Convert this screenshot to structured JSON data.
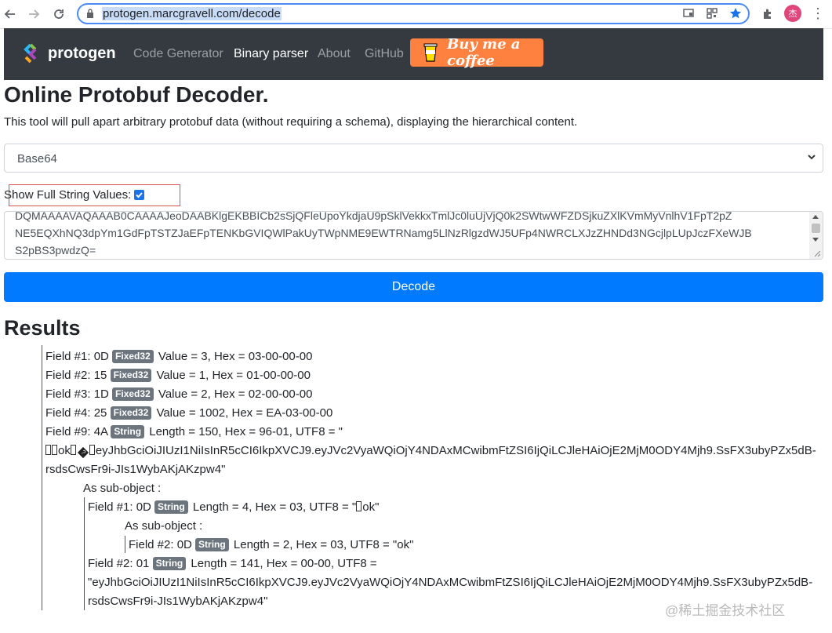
{
  "browser": {
    "url": "protogen.marcgravell.com/decode",
    "avatar_initial": "杰"
  },
  "navbar": {
    "brand": "protogen",
    "links": [
      "Code Generator",
      "Binary parser",
      "About",
      "GitHub"
    ],
    "active_link": "Binary parser",
    "coffee_label": "Buy me a coffee",
    "colors": {
      "bg": "#343a40",
      "coffee": "#ff813f"
    }
  },
  "page": {
    "title": "Online Protobuf Decoder.",
    "description": "This tool will pull apart arbitrary protobuf data (without requiring a schema), displaying the hierarchical content.",
    "encoding_select": "Base64",
    "show_full_label": "Show Full String Values:",
    "show_full_checked": true,
    "input_lines": [
      "DQMAAAAVAQAAAB0CAAAAJeoDAABKlgEKBBICb2sSjQFleUpoYkdjaU9pSklVekkxTmlJc0luUjVjQ0k2SWtwWFZDSjkuZXlKVmMyVnlhV1FpT2pZ",
      "NE5EQXhNQ3dpYm1GdFpTSTZJaEFpTENKbGVIQWlPakUyTWpNME9EWTRNamg5LlNzRlgzdWJ5UFp4NWRCLXJzZHNDd3NGcjlpLUpJczFXeWJB",
      "S2pBS3pwdzQ="
    ],
    "decode_label": "Decode",
    "results_title": "Results"
  },
  "results": {
    "f1": {
      "head": "Field #1: 0D",
      "badge": "Fixed32",
      "tail": "Value = 3, Hex = 03-00-00-00"
    },
    "f2": {
      "head": "Field #2: 15",
      "badge": "Fixed32",
      "tail": "Value = 1, Hex = 01-00-00-00"
    },
    "f3": {
      "head": "Field #3: 1D",
      "badge": "Fixed32",
      "tail": "Value = 2, Hex = 02-00-00-00"
    },
    "f4": {
      "head": "Field #4: 25",
      "badge": "Fixed32",
      "tail": "Value = 1002, Hex = EA-03-00-00"
    },
    "f9": {
      "head": "Field #9: 4A",
      "badge": "String",
      "tail": "Length = 150, Hex = 96-01, UTF8 = \"",
      "line2_a": "ok",
      "line2_b": "eyJhbGciOiJIUzI1NiIsInR5cCI6IkpXVCJ9.eyJVc2VyaWQiOjY4NDAxMCwibmFtZSI6IjQiLCJleHAiOjE2MjM0ODY4Mjh9.SsFX3ubyPZx5dB-",
      "line3": "rsdsCwsFr9i-JIs1WybAKjAKzpw4\""
    },
    "sub_label_1": "As sub-object :",
    "s1": {
      "head": "Field #1: 0D",
      "badge": "String",
      "tail": "Length = 4, Hex = 03, UTF8 = \"",
      "tail2": "ok\""
    },
    "sub_label_2": "As sub-object :",
    "s1a": {
      "head": "Field #2: 0D",
      "badge": "String",
      "tail": "Length = 2, Hex = 03, UTF8 = \"ok\""
    },
    "s2": {
      "head": "Field #2: 01",
      "badge": "String",
      "tail": "Length = 141, Hex = 00-00, UTF8 =",
      "line2": "\"eyJhbGciOiJIUzI1NiIsInR5cCI6IkpXVCJ9.eyJVc2VyaWQiOjY4NDAxMCwibmFtZSI6IjQiLCJleHAiOjE2MjM0ODY4Mjh9.SsFX3ubyPZx5dB-",
      "line3": "rsdsCwsFr9i-JIs1WybAKjAKzpw4\""
    }
  },
  "watermark": "@稀土掘金技术社区"
}
